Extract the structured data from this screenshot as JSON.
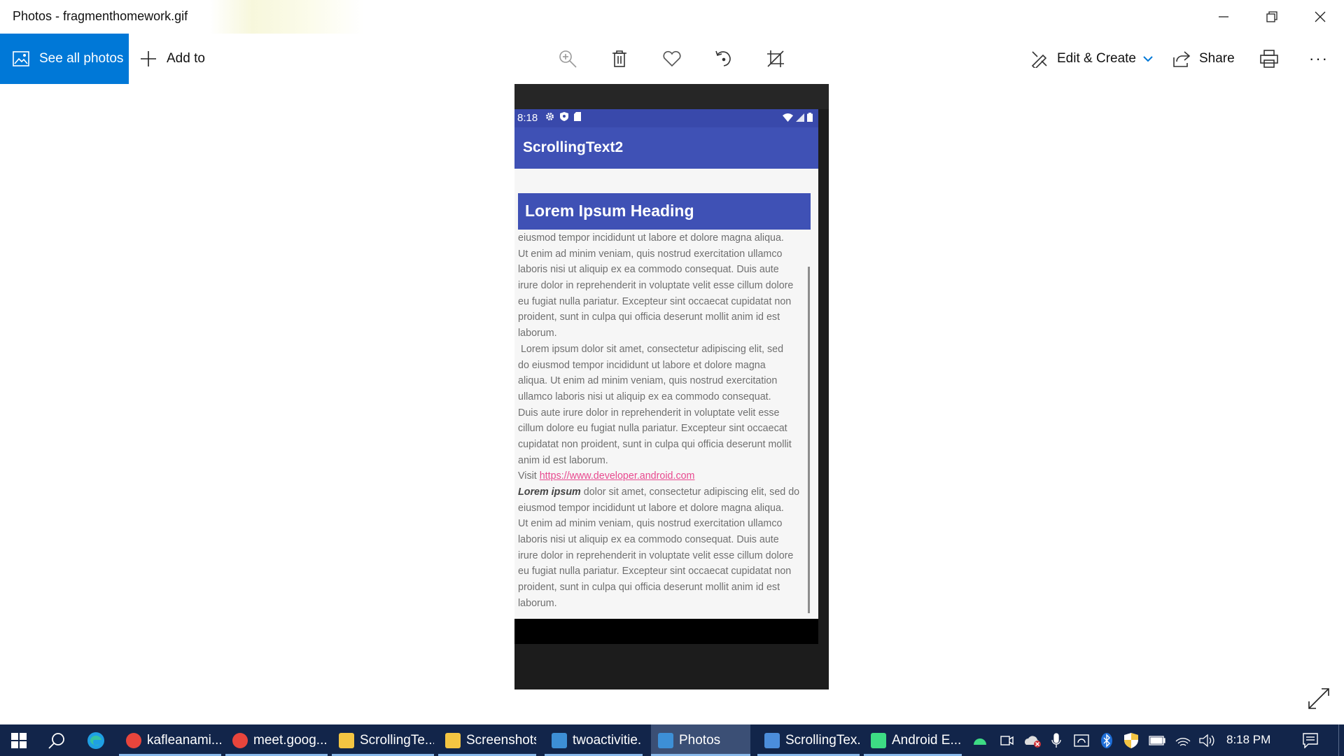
{
  "window": {
    "title": "Photos - fragmenthomework.gif"
  },
  "toolbar": {
    "see_all_label": "See all photos",
    "add_to_label": "Add to",
    "edit_create_label": "Edit & Create",
    "share_label": "Share",
    "more_label": "···"
  },
  "phone": {
    "status_time": "8:18",
    "app_title": "ScrollingText2",
    "heading": "Lorem Ipsum Heading",
    "lines_a": [
      "eiusmod tempor incididunt ut labore et dolore magna aliqua.",
      "Ut enim ad minim veniam, quis nostrud exercitation ullamco",
      "laboris nisi ut aliquip ex ea commodo consequat. Duis aute",
      "irure dolor in reprehenderit in voluptate velit esse cillum dolore",
      "eu fugiat nulla pariatur. Excepteur sint occaecat cupidatat non",
      "proident, sunt in culpa qui officia deserunt mollit anim id est",
      "laborum.",
      " Lorem ipsum dolor sit amet, consectetur adipiscing elit, sed",
      "do eiusmod tempor incididunt ut labore et dolore magna",
      "aliqua. Ut enim ad minim veniam, quis nostrud exercitation",
      "ullamco laboris nisi ut aliquip ex ea commodo consequat.",
      "Duis aute irure dolor in reprehenderit in voluptate velit esse",
      "cillum dolore eu fugiat nulla pariatur. Excepteur sint occaecat",
      "cupidatat non proident, sunt in culpa qui officia deserunt mollit",
      "anim id est laborum."
    ],
    "visit_label": "Visit ",
    "link": "https://www.developer.android.com",
    "bold_italic": "Lorem ipsum",
    "after_bold": " dolor sit amet, consectetur adipiscing elit, sed do",
    "lines_b": [
      "eiusmod tempor incididunt ut labore et dolore magna aliqua.",
      "Ut enim ad minim veniam, quis nostrud exercitation ullamco",
      "laboris nisi ut aliquip ex ea commodo consequat. Duis aute",
      "irure dolor in reprehenderit in voluptate velit esse cillum dolore",
      "eu fugiat nulla pariatur. Excepteur sint occaecat cupidatat non",
      "proident, sunt in culpa qui officia deserunt mollit anim id est",
      "laborum."
    ]
  },
  "taskbar": {
    "items": [
      {
        "label": "kafleanami...",
        "icon": "chrome-icon",
        "color": "#e8453c"
      },
      {
        "label": "meet.goog...",
        "icon": "chrome-icon",
        "color": "#e8453c"
      },
      {
        "label": "ScrollingTe...",
        "icon": "folder-icon",
        "color": "#f4c542"
      },
      {
        "label": "Screenshots",
        "icon": "folder-icon",
        "color": "#f4c542"
      },
      {
        "label": "twoactivitie...",
        "icon": "photos-icon",
        "color": "#3d8fd6"
      },
      {
        "label": "Photos",
        "icon": "photos-icon",
        "color": "#3d8fd6"
      },
      {
        "label": "ScrollingTex...",
        "icon": "android-studio-icon",
        "color": "#4b8ddb"
      },
      {
        "label": "Android E...",
        "icon": "android-emulator-icon",
        "color": "#3ddc84"
      }
    ],
    "time": "8:18 PM"
  },
  "colors": {
    "accent": "#0078d7",
    "app_primary": "#3f51b5",
    "status_bar": "#3949ab",
    "link": "#e8498f",
    "taskbar": "#12254a"
  }
}
